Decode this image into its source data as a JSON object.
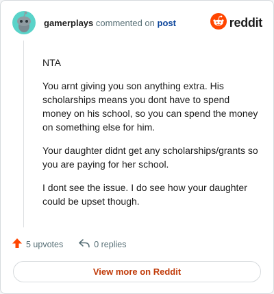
{
  "comment": {
    "username": "gamerplays",
    "action_text": "commented on",
    "post_link": "post",
    "paragraphs": [
      "NTA",
      "You arnt giving you son anything extra. His scholarships means you dont have to spend money on his school, so you can spend the money on something else for him.",
      "Your daughter didnt get any scholarships/grants so you are paying for her school.",
      "I dont see the issue. I do see how your daughter could be upset though."
    ]
  },
  "brand": {
    "word": "reddit",
    "icon": "reddit-logo-icon",
    "color": "#ff4500"
  },
  "stats": {
    "upvotes": "5 upvotes",
    "replies": "0 replies",
    "upvote_icon": "upvote-arrow-icon",
    "reply_icon": "reply-arrow-icon"
  },
  "footer": {
    "view_label": "View more on Reddit"
  },
  "colors": {
    "accent": "#ff4500",
    "link": "#0a449b",
    "button_text": "#c03a08"
  }
}
